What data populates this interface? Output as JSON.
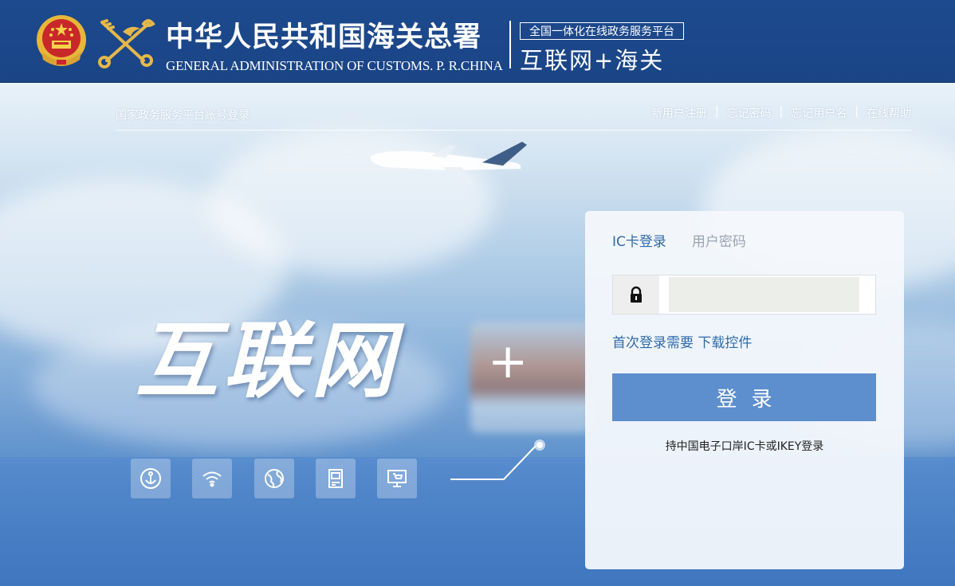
{
  "header": {
    "title_cn": "中华人民共和国海关总署",
    "title_en": "GENERAL ADMINISTRATION OF CUSTOMS. P. R.CHINA",
    "badge": "全国一体化在线政务服务平台",
    "slogan": "互联网+海关"
  },
  "nav": {
    "gov_login": "国家政务服务平台账号登录",
    "links": [
      "新用户注册",
      "忘记密码",
      "忘记用户名",
      "在线帮助"
    ],
    "separator": "|"
  },
  "hero": {
    "big_text": "互联网",
    "plus": "+",
    "features": [
      "anchor-icon",
      "wifi-icon",
      "globe-icon",
      "terminal-icon",
      "cart-monitor-icon"
    ]
  },
  "login": {
    "tabs": [
      "IC卡登录",
      "用户密码"
    ],
    "active_tab": 0,
    "pin_value": "",
    "pin_placeholder": "",
    "first_login_text": "首次登录需要",
    "download_link": "下载控件",
    "login_button": "登录",
    "hint": "持中国电子口岸IC卡或IKEY登录"
  },
  "colors": {
    "header_bg": "#1d4a8e",
    "accent_blue": "#2f6aa8",
    "button_blue": "#5d8ece"
  }
}
